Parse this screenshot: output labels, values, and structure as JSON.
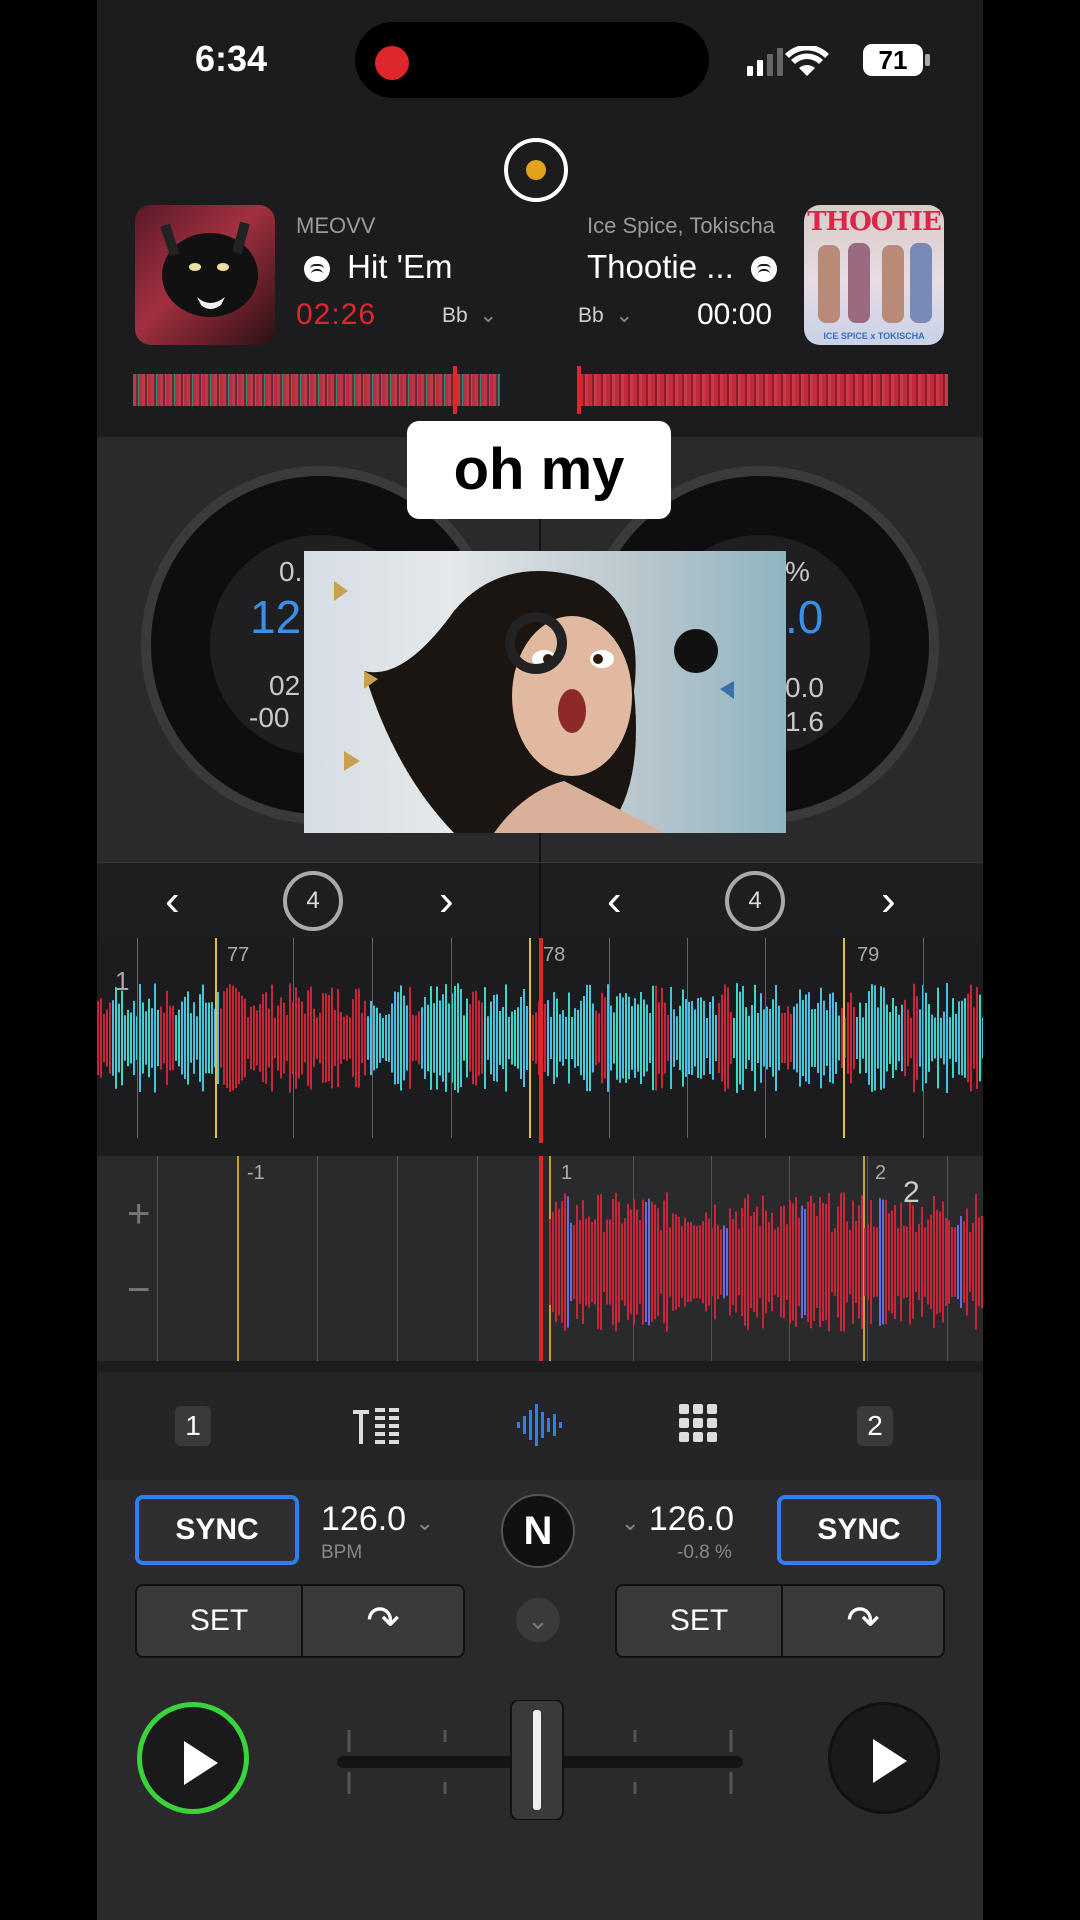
{
  "status": {
    "time": "6:34",
    "battery": "71"
  },
  "deck_a": {
    "artist": "MEOVV",
    "title": "Hit 'Em",
    "time": "02:26",
    "key": "Bb",
    "bpm_partial": "12",
    "pitch_partial": "0.",
    "elapsed_partial": "02",
    "remaining_partial": "-00",
    "sync": "SYNC",
    "bpm": "126.0",
    "bpm_label": "BPM",
    "set": "SET",
    "loop": "4",
    "tab": "1"
  },
  "deck_b": {
    "artist": "Ice Spice, Tokischa",
    "title": "Thootie ...",
    "time": "00:00",
    "key": "Bb",
    "art_title": "THOOTIE",
    "art_sub": "ICE SPICE x TOKISCHA",
    "bpm_partial": ".0",
    "pitch_partial": "%",
    "line1_partial": "0.0",
    "line2_partial": "1.6",
    "sync": "SYNC",
    "bpm": "126.0",
    "pitch": "-0.8 %",
    "set": "SET",
    "loop": "4",
    "tab": "2"
  },
  "caption": "oh my",
  "waveform_a": {
    "bars": [
      "77",
      "78",
      "79"
    ],
    "deck": "1"
  },
  "waveform_b": {
    "bars": [
      "-1",
      "1",
      "2"
    ],
    "deck": "2"
  },
  "colors": {
    "accent": "#2f7ff0",
    "red": "#e0262d",
    "green": "#3ad43a"
  }
}
